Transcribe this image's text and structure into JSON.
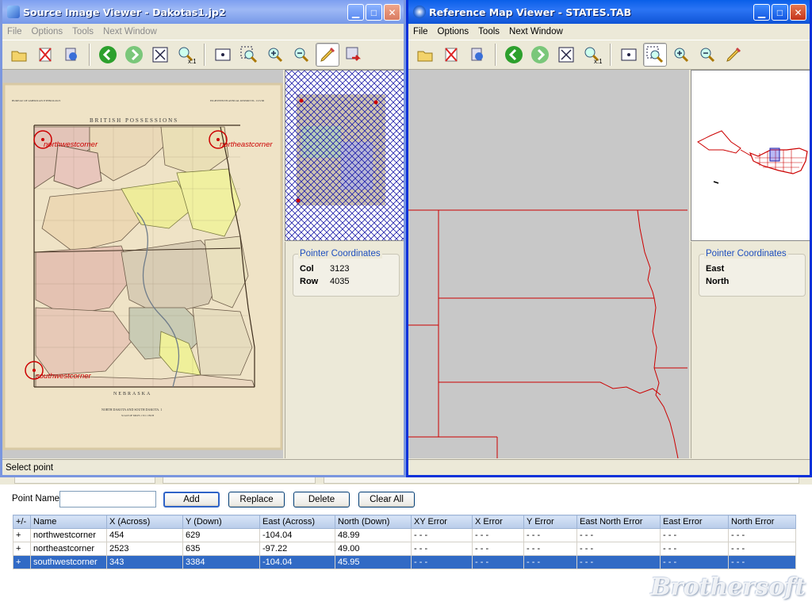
{
  "source_window": {
    "title": "Source Image Viewer - Dakotas1.jp2",
    "menu": [
      "File",
      "Options",
      "Tools",
      "Next Window"
    ],
    "toolbar_icons": [
      "open-folder-icon",
      "clear-icon",
      "properties-icon",
      "back-arrow-icon",
      "forward-arrow-icon",
      "zoom-extent-icon",
      "zoom-1-to-1-icon",
      "center-point-icon",
      "zoom-box-icon",
      "zoom-in-icon",
      "zoom-out-icon",
      "pencil-icon",
      "export-icon"
    ],
    "map_header_left": "BUREAU OF AMERICAN ETHNOLOGY",
    "map_header_right": "EIGHTEENTH ANNUAL REPORT PL. CLVIII",
    "map_labels": {
      "british": "BRITISH POSSESSIONS",
      "nebraska": "NEBRASKA",
      "title": "NORTH DAKOTA AND SOUTH DAKOTA. 1",
      "scale": "SCALE OF MILES 1 TO 1 INCH"
    },
    "points": [
      {
        "label": "northwestcorner"
      },
      {
        "label": "northeastcorner"
      },
      {
        "label": "southwestcorner"
      }
    ],
    "pointer": {
      "legend": "Pointer Coordinates",
      "col_label": "Col",
      "col_value": "3123",
      "row_label": "Row",
      "row_value": "4035"
    },
    "status": "Select point"
  },
  "reference_window": {
    "title": "Reference Map Viewer - STATES.TAB",
    "menu": [
      "File",
      "Options",
      "Tools",
      "Next Window"
    ],
    "pointer": {
      "legend": "Pointer Coordinates",
      "east_label": "East",
      "north_label": "North"
    }
  },
  "form": {
    "point_name_label": "Point Name",
    "point_name_value": "",
    "add": "Add",
    "replace": "Replace",
    "delete": "Delete",
    "clear_all": "Clear All"
  },
  "table": {
    "headers": [
      "+/-",
      "Name",
      "X (Across)",
      "Y (Down)",
      "East (Across)",
      "North (Down)",
      "XY Error",
      "X Error",
      "Y Error",
      "East North Error",
      "East Error",
      "North Error"
    ],
    "rows": [
      [
        "+",
        "northwestcorner",
        "454",
        "629",
        "-104.04",
        "48.99",
        "- - -",
        "- - -",
        "- - -",
        "- - -",
        "- - -",
        "- - -"
      ],
      [
        "+",
        "northeastcorner",
        "2523",
        "635",
        "-97.22",
        "49.00",
        "- - -",
        "- - -",
        "- - -",
        "- - -",
        "- - -",
        "- - -"
      ],
      [
        "+",
        "southwestcorner",
        "343",
        "3384",
        "-104.04",
        "45.95",
        "- - -",
        "- - -",
        "- - -",
        "- - -",
        "- - -",
        "- - -"
      ]
    ],
    "selected_row": 2
  },
  "watermark": "Brothersoft",
  "colors": {
    "title_blue": "#0a5fe8",
    "selection": "#316ac5",
    "marker_red": "#cc0000",
    "reference_lines": "#cc0000"
  }
}
